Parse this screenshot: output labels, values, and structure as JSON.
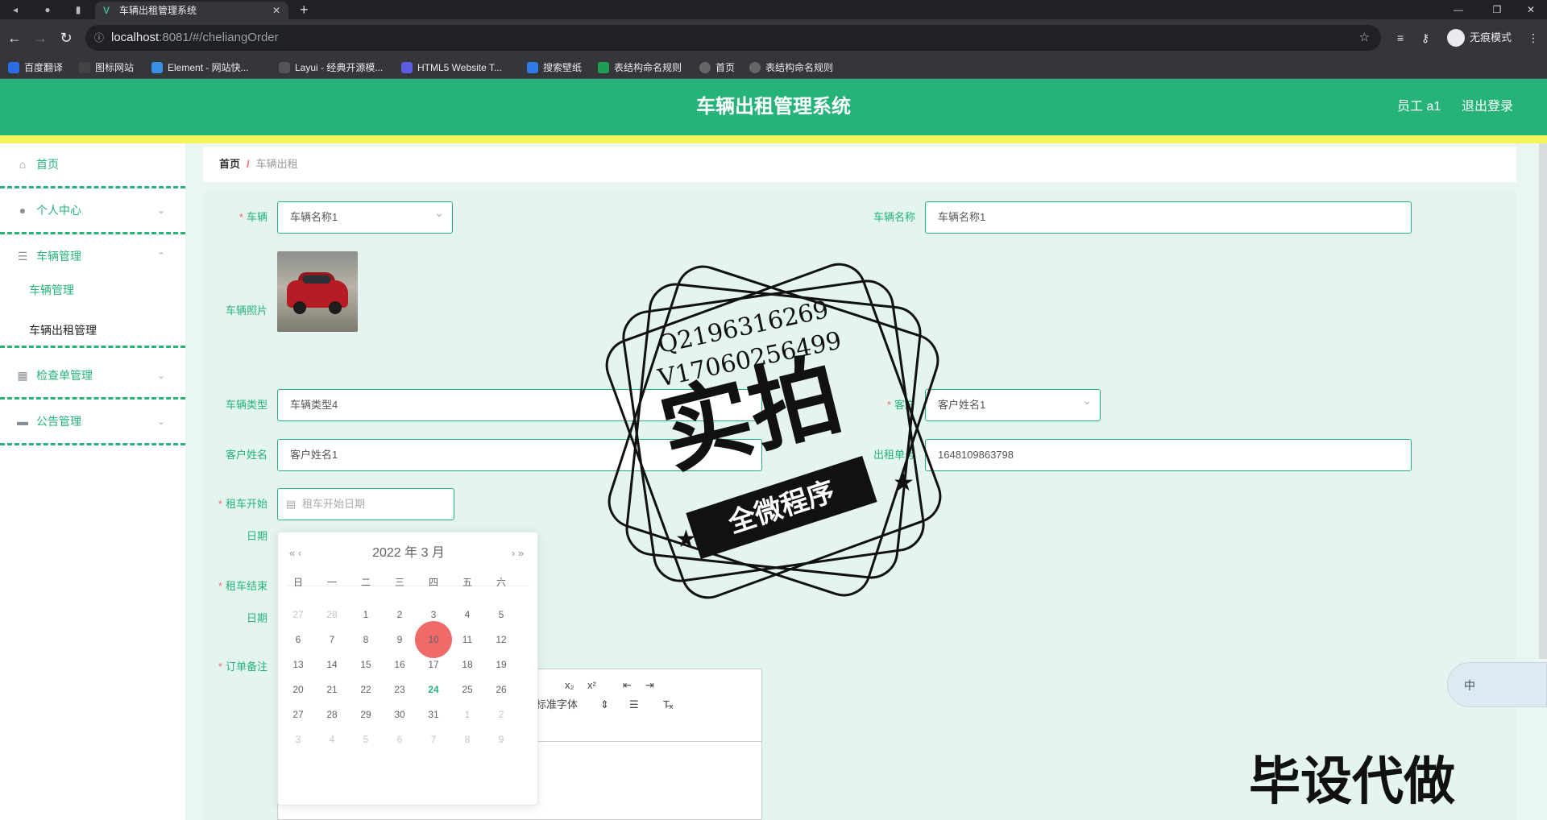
{
  "browser": {
    "tab_title": "车辆出租管理系统",
    "url_host": "localhost",
    "url_path": ":8081/#/cheliangOrder",
    "incognito_label": "无痕模式",
    "bookmarks": [
      "百度翻译",
      "图标网站",
      "Element - 网站快...",
      "Layui - 经典开源模...",
      "HTML5 Website T...",
      "搜索壁纸",
      "表结构命名规则",
      "首页",
      "表结构命名规则"
    ]
  },
  "header": {
    "title": "车辆出租管理系统",
    "user": "员工 a1",
    "logout": "退出登录",
    "accent": "#25b37a"
  },
  "sidebar": {
    "items": [
      {
        "label": "首页",
        "icon": "home-icon"
      },
      {
        "label": "个人中心",
        "icon": "user-icon"
      },
      {
        "label": "车辆管理",
        "icon": "list-icon"
      },
      {
        "label": "检查单管理",
        "icon": "grid-icon"
      },
      {
        "label": "公告管理",
        "icon": "ticket-icon"
      }
    ],
    "subitems": [
      "车辆管理",
      "车辆出租管理"
    ]
  },
  "breadcrumb": {
    "home": "首页",
    "sep": "/",
    "current": "车辆出租"
  },
  "form": {
    "vehicle_label": "车辆",
    "vehicle_value": "车辆名称1",
    "vehicle_name_label": "车辆名称",
    "vehicle_name_value": "车辆名称1",
    "photo_label": "车辆照片",
    "type_label": "车辆类型",
    "type_value": "车辆类型4",
    "customer_label": "客户",
    "customer_value": "客户姓名1",
    "customer_name_label": "客户姓名",
    "customer_name_value": "客户姓名1",
    "order_no_label": "出租单号",
    "order_no_value": "1648109863798",
    "start_label": "租车开始",
    "start_label2": "日期",
    "start_placeholder": "租车开始日期",
    "end_label": "租车结束",
    "end_label2": "日期",
    "remark_label": "订单备注"
  },
  "datepicker": {
    "title": "2022 年  3 月",
    "prev": "«  ‹",
    "next": "›  »",
    "weekdays": [
      "日",
      "一",
      "二",
      "三",
      "四",
      "五",
      "六"
    ],
    "rows": [
      [
        "27",
        "28",
        "1",
        "2",
        "3",
        "4",
        "5"
      ],
      [
        "6",
        "7",
        "8",
        "9",
        "10",
        "11",
        "12"
      ],
      [
        "13",
        "14",
        "15",
        "16",
        "17",
        "18",
        "19"
      ],
      [
        "20",
        "21",
        "22",
        "23",
        "24",
        "25",
        "26"
      ],
      [
        "27",
        "28",
        "29",
        "30",
        "31",
        "1",
        "2"
      ],
      [
        "3",
        "4",
        "5",
        "6",
        "7",
        "8",
        "9"
      ]
    ],
    "today": "24",
    "selected": "10"
  },
  "editor": {
    "subscript": "x₂",
    "superscript": "x²",
    "font_select": "标准字体",
    "clear_format": "T̶ₓ"
  },
  "watermark": {
    "line1": "Q2196316269",
    "line2": "V17060256499",
    "big": "实拍",
    "banner": "全微程序",
    "corner": "毕设代做"
  },
  "ime": {
    "label": "中"
  }
}
